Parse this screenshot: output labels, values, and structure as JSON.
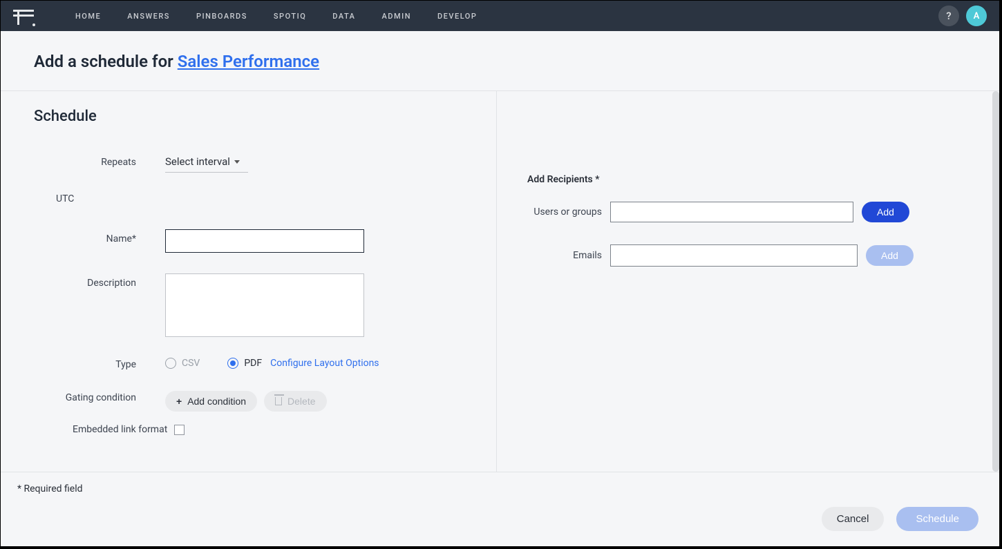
{
  "nav": {
    "items": [
      "HOME",
      "ANSWERS",
      "PINBOARDS",
      "SPOTIQ",
      "DATA",
      "ADMIN",
      "DEVELOP"
    ],
    "help_label": "?",
    "avatar_initial": "A"
  },
  "header": {
    "prefix": "Add a schedule for ",
    "link_text": "Sales Performance"
  },
  "schedule": {
    "section_title": "Schedule",
    "repeats_label": "Repeats",
    "interval_placeholder": "Select interval",
    "tz_label": "UTC",
    "name_label": "Name*",
    "name_value": "",
    "description_label": "Description",
    "description_value": "",
    "type_label": "Type",
    "type_options": {
      "csv": "CSV",
      "pdf": "PDF"
    },
    "configure_link": "Configure Layout Options",
    "gating_label": "Gating condition",
    "add_condition_label": "Add condition",
    "delete_label": "Delete",
    "embedded_label": "Embedded link format"
  },
  "recipients": {
    "heading": "Add Recipients *",
    "users_label": "Users or groups",
    "emails_label": "Emails",
    "add_users_label": "Add",
    "add_emails_label": "Add"
  },
  "footer": {
    "required_note": "* Required field",
    "cancel_label": "Cancel",
    "schedule_label": "Schedule"
  }
}
